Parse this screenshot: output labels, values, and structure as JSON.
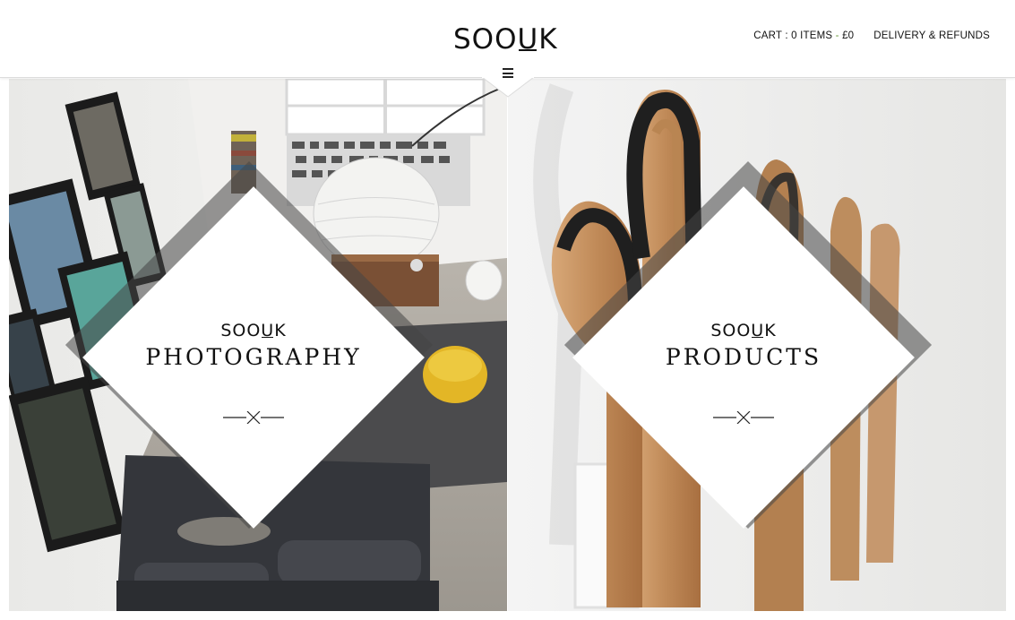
{
  "header": {
    "logo_prefix": "SOO",
    "logo_u": "U",
    "logo_suffix": "K",
    "cart_label": "CART : 0 ITEMS",
    "cart_dash": " - ",
    "cart_price": "£0",
    "delivery_label": "DELIVERY & REFUNDS"
  },
  "panels": [
    {
      "logo_prefix": "SOO",
      "logo_u": "U",
      "logo_suffix": "K",
      "title": "PHOTOGRAPHY"
    },
    {
      "logo_prefix": "SOO",
      "logo_u": "U",
      "logo_suffix": "K",
      "title": "PRODUCTS"
    }
  ],
  "icons": {
    "menu": "hamburger-icon",
    "cross": "crossed-lines-icon"
  },
  "colors": {
    "text": "#111111",
    "accent_dash": "#6a9a3a",
    "overlay": "#464646"
  }
}
